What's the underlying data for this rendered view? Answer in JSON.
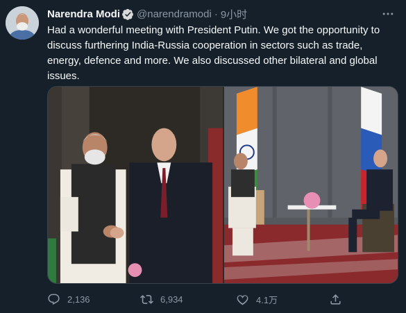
{
  "tweet": {
    "author_name": "Narendra Modi",
    "handle": "@narendramodi",
    "separator": "·",
    "time": "9小时",
    "text": "Had a wonderful meeting with President Putin. We got the opportunity to discuss furthering India-Russia cooperation in sectors such as trade, energy, defence and more. We also discussed other bilateral and global issues.",
    "verified": true
  },
  "actions": {
    "replies": "2,136",
    "retweets": "6,934",
    "likes": "4.1万"
  },
  "icons": {
    "avatar": "profile-avatar",
    "verified": "verified-badge-icon",
    "more": "more-options-icon",
    "reply": "reply-icon",
    "retweet": "retweet-icon",
    "like": "heart-icon",
    "share": "share-icon"
  },
  "colors": {
    "background": "#15202b",
    "text_primary": "#f7f9f9",
    "text_secondary": "#8b98a5",
    "verified": "#d9d9d9"
  }
}
